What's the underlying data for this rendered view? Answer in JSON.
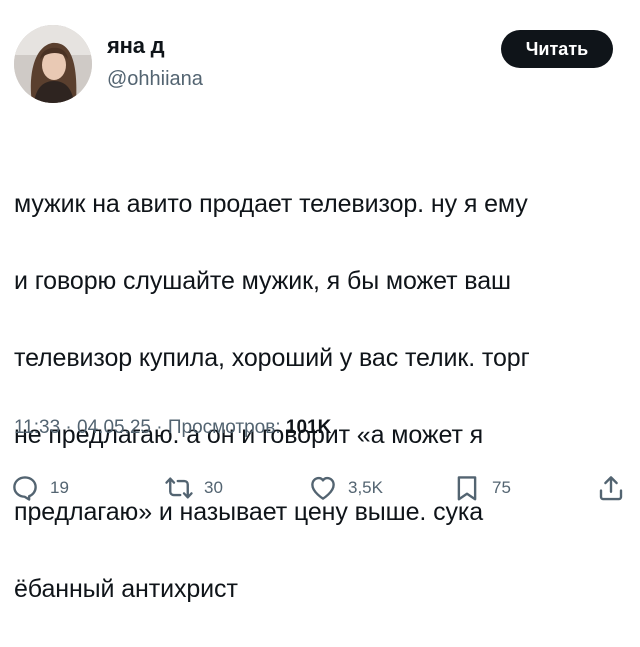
{
  "author": {
    "name": "яна д",
    "handle": "@ohhiiana"
  },
  "follow_button": {
    "label": "Читать"
  },
  "tweet": {
    "text_lines": [
      "мужик на авито продает телевизор. ну я ему",
      "и говорю слушайте мужик, я бы может ваш",
      "телевизор купила, хороший у вас телик. торг",
      "не предлагаю. а он и говорит «а может я",
      "предлагаю» и называет цену выше. сука",
      "ёбанный антихрист"
    ]
  },
  "meta": {
    "time": "11:33",
    "separator": " · ",
    "date": "04.05.25",
    "views_label": "Просмотров:",
    "views_count": "101K"
  },
  "actions": {
    "replies": {
      "icon": "reply-icon",
      "count": "19"
    },
    "reposts": {
      "icon": "repost-icon",
      "count": "30"
    },
    "likes": {
      "icon": "heart-icon",
      "count": "3,5K"
    },
    "bookmarks": {
      "icon": "bookmark-icon",
      "count": "75"
    },
    "share": {
      "icon": "share-icon"
    }
  },
  "colors": {
    "text_primary": "#0f1419",
    "text_secondary": "#536471",
    "button_bg": "#0f1419",
    "button_text": "#ffffff",
    "background": "#ffffff"
  }
}
